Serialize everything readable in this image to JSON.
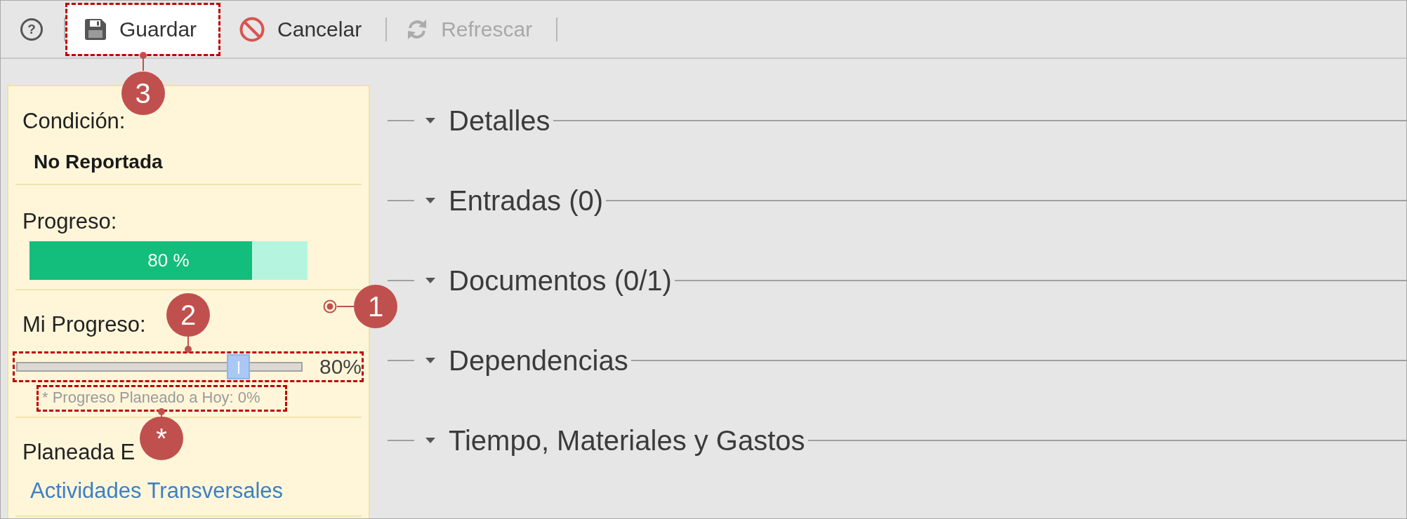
{
  "toolbar": {
    "help_button": "?",
    "buttons": [
      {
        "label": "Guardar",
        "highlighted": true,
        "disabled": false,
        "callout": "3"
      },
      {
        "label": "Cancelar",
        "highlighted": false,
        "disabled": false
      },
      {
        "label": "Refrescar",
        "highlighted": false,
        "disabled": true
      }
    ]
  },
  "details_panel": {
    "callout": "1",
    "fields": [
      {
        "kind": "text",
        "label": "Condición:",
        "value": "No Reportada"
      },
      {
        "kind": "progress",
        "label": "Progreso:",
        "level": 0.8,
        "reading": "80 %"
      },
      {
        "kind": "slider",
        "label": "Mi Progreso:",
        "level": 0.8,
        "reading": "80%",
        "callout": "2",
        "note": "* Progreso Planeado a Hoy: 0%",
        "note_callout": "*"
      },
      {
        "kind": "link",
        "label": "Planeada E",
        "value": "Actividades Transversales"
      }
    ]
  },
  "sections": [
    {
      "title": "Detalles"
    },
    {
      "title": "Entradas (0)"
    },
    {
      "title": "Documentos (0/1)"
    },
    {
      "title": "Dependencias"
    },
    {
      "title": "Tiempo, Materiales y Gastos"
    }
  ]
}
